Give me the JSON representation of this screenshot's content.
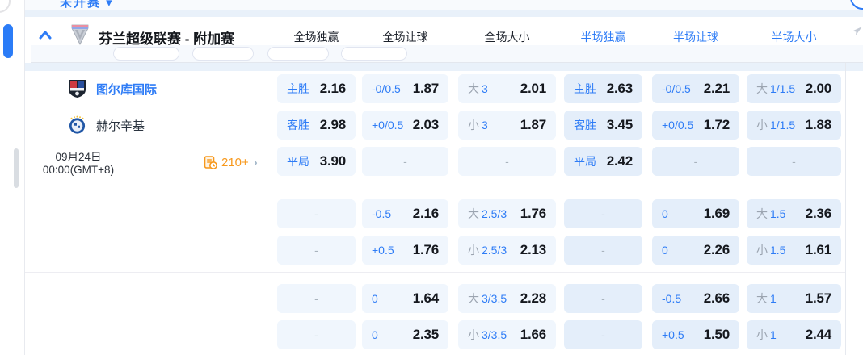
{
  "top_bar": {
    "partial_tab": "未开赛 ▾"
  },
  "league_header": {
    "title": "芬兰超级联赛 - 附加赛",
    "columns": [
      {
        "label": "全场独赢",
        "scope": "full"
      },
      {
        "label": "全场让球",
        "scope": "full"
      },
      {
        "label": "全场大小",
        "scope": "full"
      },
      {
        "label": "半场独赢",
        "scope": "half"
      },
      {
        "label": "半场让球",
        "scope": "half"
      },
      {
        "label": "半场大小",
        "scope": "half"
      }
    ]
  },
  "match": {
    "home_team": "图尔库国际",
    "away_team": "赫尔辛基",
    "date_line1": "09月24日",
    "date_line2": "00:00(GMT+8)",
    "markets_count": "210+"
  },
  "odds": {
    "groups": [
      {
        "rows": [
          [
            {
              "label": "主胜",
              "odds": "2.16"
            },
            {
              "label": "-0/0.5",
              "odds": "1.87"
            },
            {
              "prefix": "大",
              "label": "3",
              "odds": "2.01"
            },
            {
              "label": "主胜",
              "odds": "2.63"
            },
            {
              "label": "-0/0.5",
              "odds": "2.21"
            },
            {
              "prefix": "大",
              "label": "1/1.5",
              "odds": "2.00"
            }
          ],
          [
            {
              "label": "客胜",
              "odds": "2.98"
            },
            {
              "label": "+0/0.5",
              "odds": "2.03"
            },
            {
              "prefix": "小",
              "label": "3",
              "odds": "1.87"
            },
            {
              "label": "客胜",
              "odds": "3.45"
            },
            {
              "label": "+0/0.5",
              "odds": "1.72"
            },
            {
              "prefix": "小",
              "label": "1/1.5",
              "odds": "1.88"
            }
          ],
          [
            {
              "label": "平局",
              "odds": "3.90"
            },
            {
              "placeholder": "-"
            },
            {
              "placeholder": "-"
            },
            {
              "label": "平局",
              "odds": "2.42"
            },
            {
              "placeholder": "-"
            },
            {
              "placeholder": "-"
            }
          ]
        ]
      },
      {
        "rows": [
          [
            {
              "placeholder": "-"
            },
            {
              "label": "-0.5",
              "odds": "2.16"
            },
            {
              "prefix": "大",
              "label": "2.5/3",
              "odds": "1.76"
            },
            {
              "placeholder": "-"
            },
            {
              "label": "0",
              "odds": "1.69"
            },
            {
              "prefix": "大",
              "label": "1.5",
              "odds": "2.36"
            }
          ],
          [
            {
              "placeholder": "-"
            },
            {
              "label": "+0.5",
              "odds": "1.76"
            },
            {
              "prefix": "小",
              "label": "2.5/3",
              "odds": "2.13"
            },
            {
              "placeholder": "-"
            },
            {
              "label": "0",
              "odds": "2.26"
            },
            {
              "prefix": "小",
              "label": "1.5",
              "odds": "1.61"
            }
          ]
        ]
      },
      {
        "rows": [
          [
            {
              "placeholder": "-"
            },
            {
              "label": "0",
              "odds": "1.64"
            },
            {
              "prefix": "大",
              "label": "3/3.5",
              "odds": "2.28"
            },
            {
              "placeholder": "-"
            },
            {
              "label": "-0.5",
              "odds": "2.66"
            },
            {
              "prefix": "大",
              "label": "1",
              "odds": "1.57"
            }
          ],
          [
            {
              "placeholder": "-"
            },
            {
              "label": "0",
              "odds": "2.35"
            },
            {
              "prefix": "小",
              "label": "3/3.5",
              "odds": "1.66"
            },
            {
              "placeholder": "-"
            },
            {
              "label": "+0.5",
              "odds": "1.50"
            },
            {
              "prefix": "小",
              "label": "1",
              "odds": "2.44"
            }
          ]
        ]
      }
    ]
  },
  "colors": {
    "accent_blue": "#2e7cf6",
    "orange": "#f7981c",
    "cell_full_bg": "#f0f6fd",
    "cell_half_bg": "#e4eefa"
  }
}
